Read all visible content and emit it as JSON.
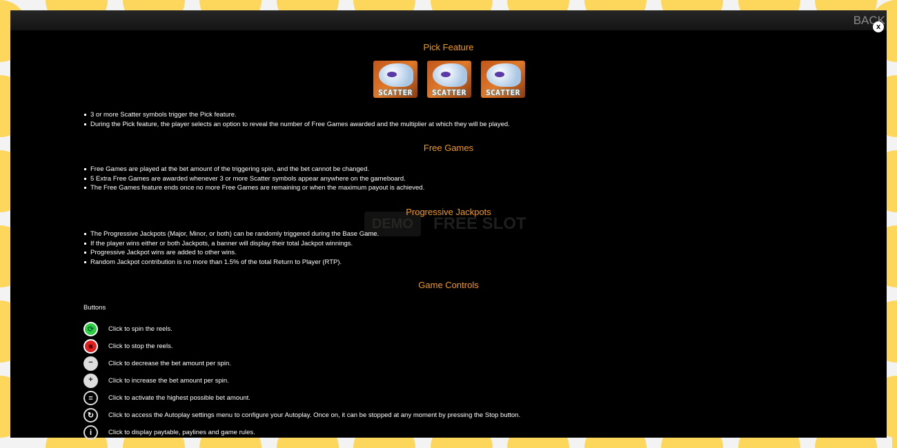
{
  "header": {
    "back_label": "BACK",
    "close_label": "x"
  },
  "watermark": {
    "demo": "DEMO",
    "free_slot": "FREE SLOT"
  },
  "pick_feature": {
    "title": "Pick Feature",
    "symbol_label": "SCATTER",
    "bullets": [
      "3 or more Scatter symbols trigger the Pick feature.",
      "During the Pick feature, the player selects an option to reveal the number of Free Games awarded and the multiplier at which they will be played."
    ]
  },
  "free_games": {
    "title": "Free Games",
    "bullets": [
      "Free Games are played at the bet amount of the triggering spin, and the bet cannot be changed.",
      "5 Extra Free Games are awarded whenever 3 or more Scatter symbols appear anywhere on the gameboard.",
      "The Free Games feature ends once no more Free Games are remaining or when the maximum payout is achieved."
    ]
  },
  "jackpots": {
    "title": "Progressive Jackpots",
    "bullets": [
      "The Progressive Jackpots (Major, Minor, or both) can be randomly triggered during the Base Game.",
      "If the player wins either or both Jackpots, a banner will display their total Jackpot winnings.",
      "Progressive Jackpot wins are added to other wins.",
      "Random Jackpot contribution is no more than 1.5% of the total Return to Player (RTP)."
    ]
  },
  "controls": {
    "title": "Game Controls",
    "buttons_label": "Buttons",
    "items": [
      {
        "icon": "spin-icon",
        "glyph": "⟳",
        "text": "Click to spin the reels."
      },
      {
        "icon": "stop-icon",
        "glyph": "■",
        "text": "Click to stop the reels."
      },
      {
        "icon": "minus-icon",
        "glyph": "−",
        "text": "Click to decrease the bet amount per spin."
      },
      {
        "icon": "plus-icon",
        "glyph": "+",
        "text": "Click to increase the bet amount per spin."
      },
      {
        "icon": "max-bet-icon",
        "glyph": "≡",
        "text": "Click to activate the highest possible bet amount."
      },
      {
        "icon": "autoplay-icon",
        "glyph": "↻",
        "text": "Click to access the Autoplay settings menu to configure your Autoplay. Once on, it can be stopped at any moment by pressing the Stop button."
      },
      {
        "icon": "info-icon",
        "glyph": "i",
        "text": "Click to display paytable, paylines and game rules."
      }
    ]
  },
  "colors": {
    "heading": "#f39c12",
    "frame_yellow": "#fcd75c",
    "spin_green": "#2ecc40",
    "stop_red": "#e02020"
  }
}
